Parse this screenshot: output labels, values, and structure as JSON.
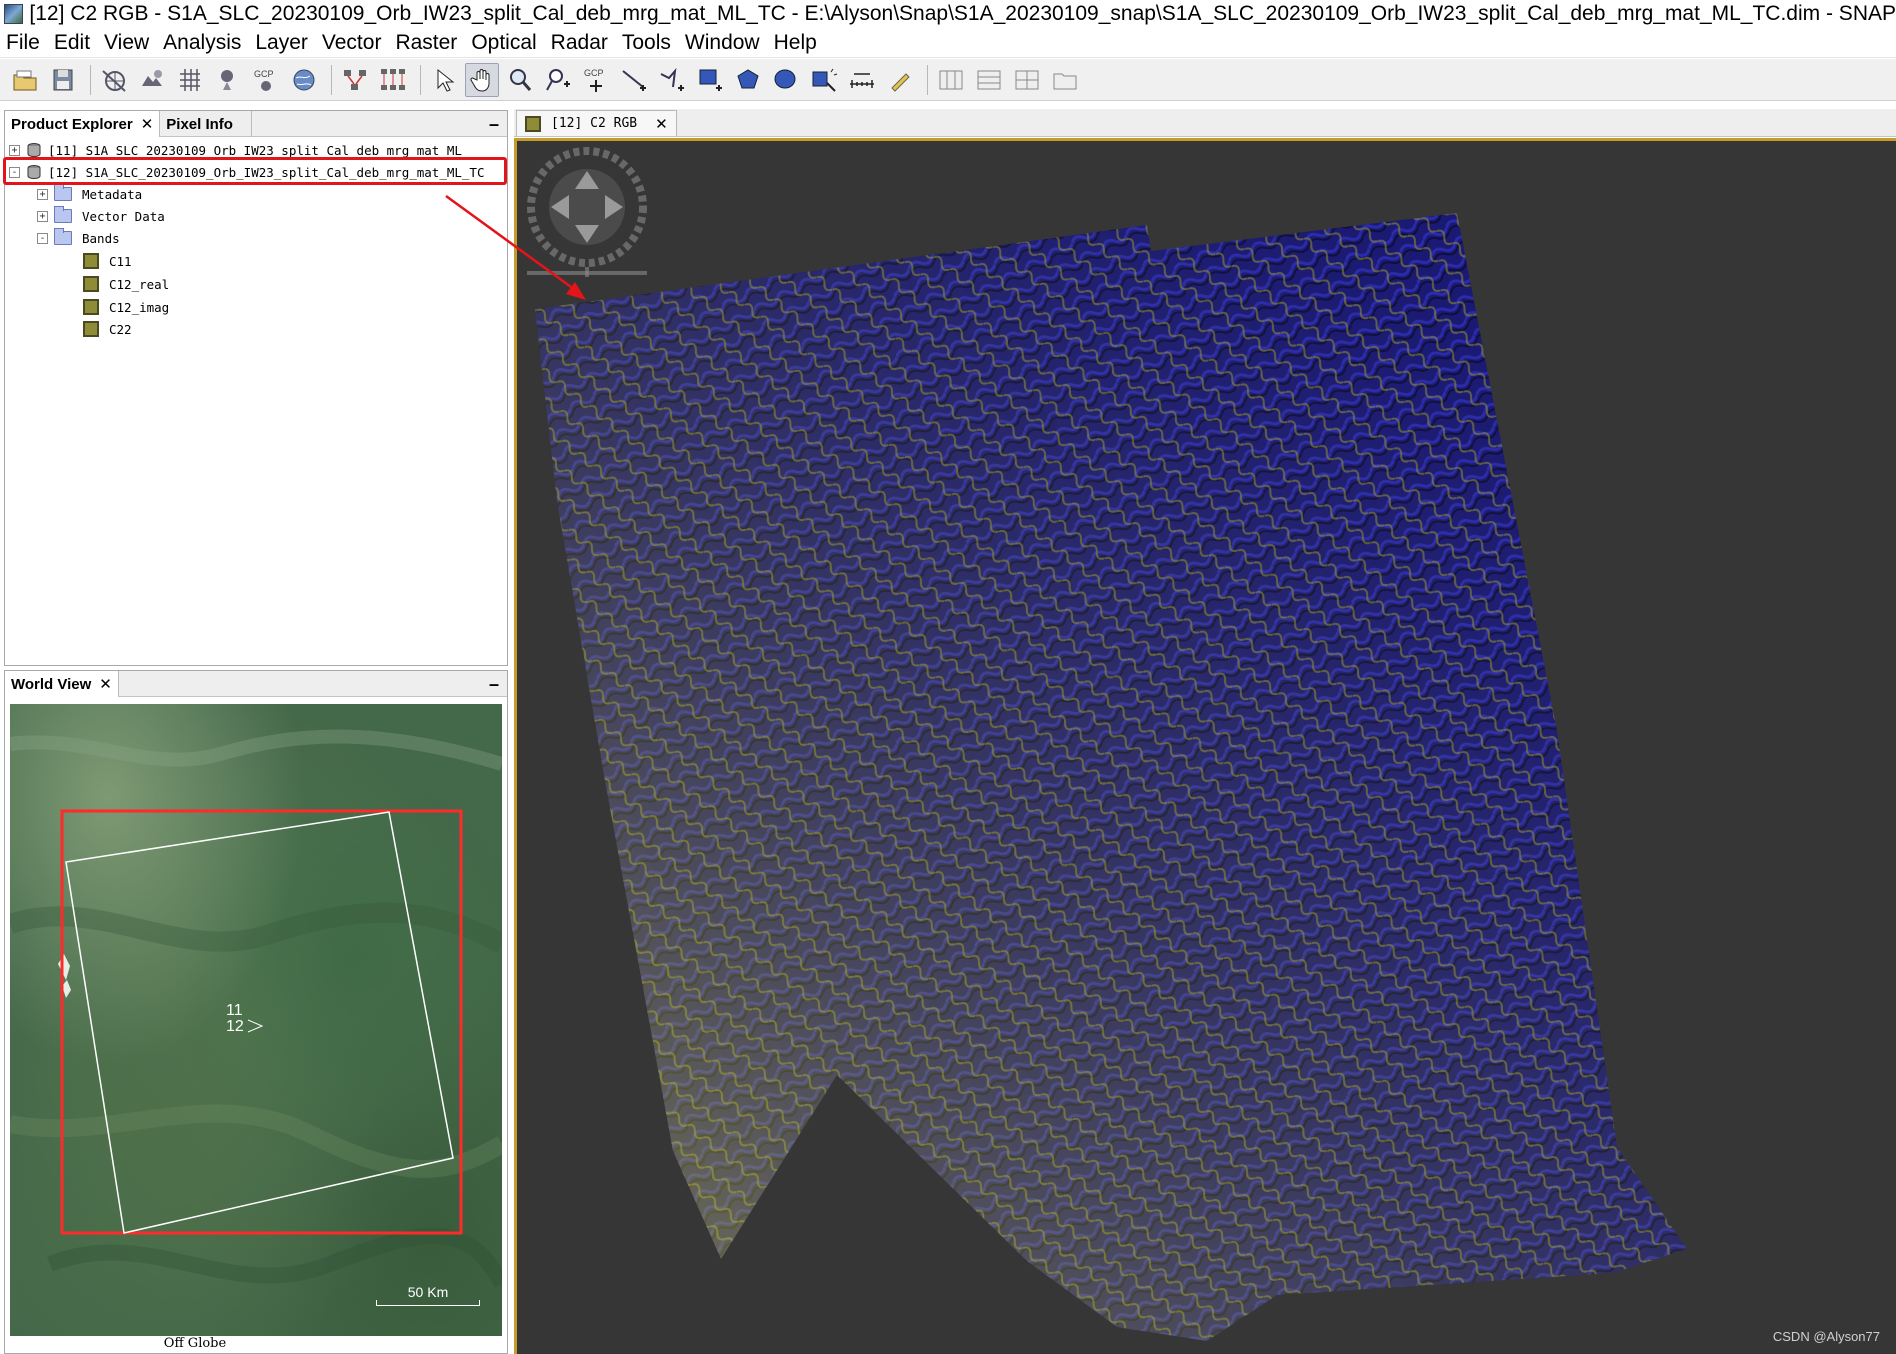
{
  "window": {
    "title": "[12] C2 RGB - S1A_SLC_20230109_Orb_IW23_split_Cal_deb_mrg_mat_ML_TC - E:\\Alyson\\Snap\\S1A_20230109_snap\\S1A_SLC_20230109_Orb_IW23_split_Cal_deb_mrg_mat_ML_TC.dim - SNAP"
  },
  "menu": [
    "File",
    "Edit",
    "View",
    "Analysis",
    "Layer",
    "Vector",
    "Raster",
    "Optical",
    "Radar",
    "Tools",
    "Window",
    "Help"
  ],
  "toolbar": {
    "gcp_label": "GCP",
    "gcp_label2": "GCP"
  },
  "product_explorer": {
    "tab_active": "Product Explorer",
    "tab_close": "✕",
    "tab_other": "Pixel Info",
    "minimize": "–",
    "products": [
      {
        "label": "[11] S1A_SLC_20230109_Orb_IW23_split_Cal_deb_mrg_mat_ML",
        "expanded": "+"
      },
      {
        "label": "[12] S1A_SLC_20230109_Orb_IW23_split_Cal_deb_mrg_mat_ML_TC",
        "expanded": "-"
      }
    ],
    "folders": [
      {
        "label": "Metadata",
        "expanded": "+"
      },
      {
        "label": "Vector Data",
        "expanded": "+"
      },
      {
        "label": "Bands",
        "expanded": "-"
      }
    ],
    "bands": [
      "C11",
      "C12_real",
      "C12_imag",
      "C22"
    ]
  },
  "world_view": {
    "tab": "World View",
    "tab_close": "✕",
    "minimize": "–",
    "product_labels": [
      "11",
      "12"
    ],
    "scale": "50 Km",
    "footer": "Off Globe"
  },
  "image_view": {
    "tab": "[12] C2 RGB",
    "tab_close": "✕"
  },
  "watermark": "CSDN @Alyson77",
  "colors": {
    "highlight": "#e3141a",
    "viewer_bg": "#363636",
    "viewer_border": "#c79a2c",
    "sar_blue": "#1c1a7a",
    "sar_yellow": "#d8d84a"
  }
}
